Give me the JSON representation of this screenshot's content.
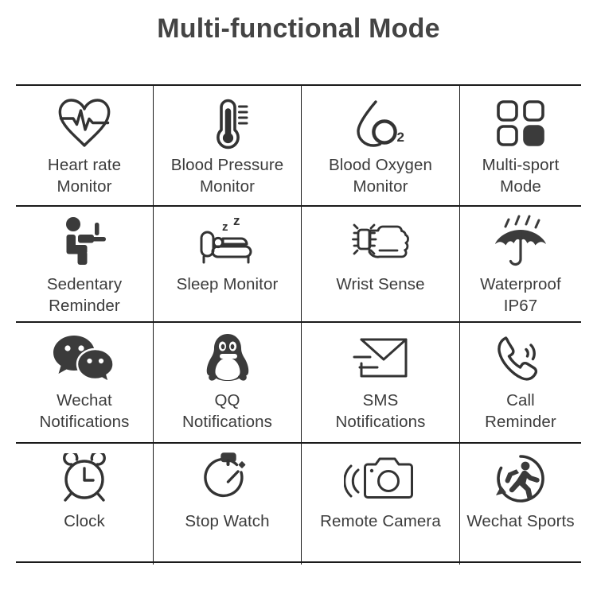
{
  "header": {
    "title": "Multi-functional Mode"
  },
  "colors": {
    "text": "#3c3c3c",
    "title": "#444444",
    "line": "#1a1a1a",
    "background": "#ffffff",
    "icon_stroke": "#333333",
    "icon_fill": "#3b3b3b"
  },
  "grid": {
    "columns": 4,
    "rows": 4,
    "cells": [
      {
        "icon": "heart-rate-icon",
        "label": "Heart rate\nMonitor"
      },
      {
        "icon": "thermometer-icon",
        "label": "Blood Pressure\nMonitor"
      },
      {
        "icon": "blood-oxygen-icon",
        "label": "Blood Oxygen\nMonitor"
      },
      {
        "icon": "multi-sport-icon",
        "label": "Multi-sport\nMode"
      },
      {
        "icon": "sedentary-icon",
        "label": "Sedentary\nReminder"
      },
      {
        "icon": "sleep-bed-icon",
        "label": "Sleep Monitor"
      },
      {
        "icon": "wrist-sense-icon",
        "label": "Wrist Sense"
      },
      {
        "icon": "umbrella-rain-icon",
        "label": "Waterproof\nIP67"
      },
      {
        "icon": "wechat-icon",
        "label": "Wechat\nNotifications"
      },
      {
        "icon": "qq-penguin-icon",
        "label": "QQ\nNotifications"
      },
      {
        "icon": "envelope-icon",
        "label": "SMS\nNotifications"
      },
      {
        "icon": "phone-call-icon",
        "label": "Call\nReminder"
      },
      {
        "icon": "alarm-clock-icon",
        "label": "Clock"
      },
      {
        "icon": "stopwatch-icon",
        "label": "Stop Watch"
      },
      {
        "icon": "remote-camera-icon",
        "label": "Remote Camera"
      },
      {
        "icon": "wechat-sports-icon",
        "label": "Wechat Sports"
      }
    ]
  },
  "icon_text": {
    "blood_oxygen": "O",
    "blood_oxygen_sub": "2",
    "sleep_z_small": "z",
    "sleep_z_large": "z"
  }
}
